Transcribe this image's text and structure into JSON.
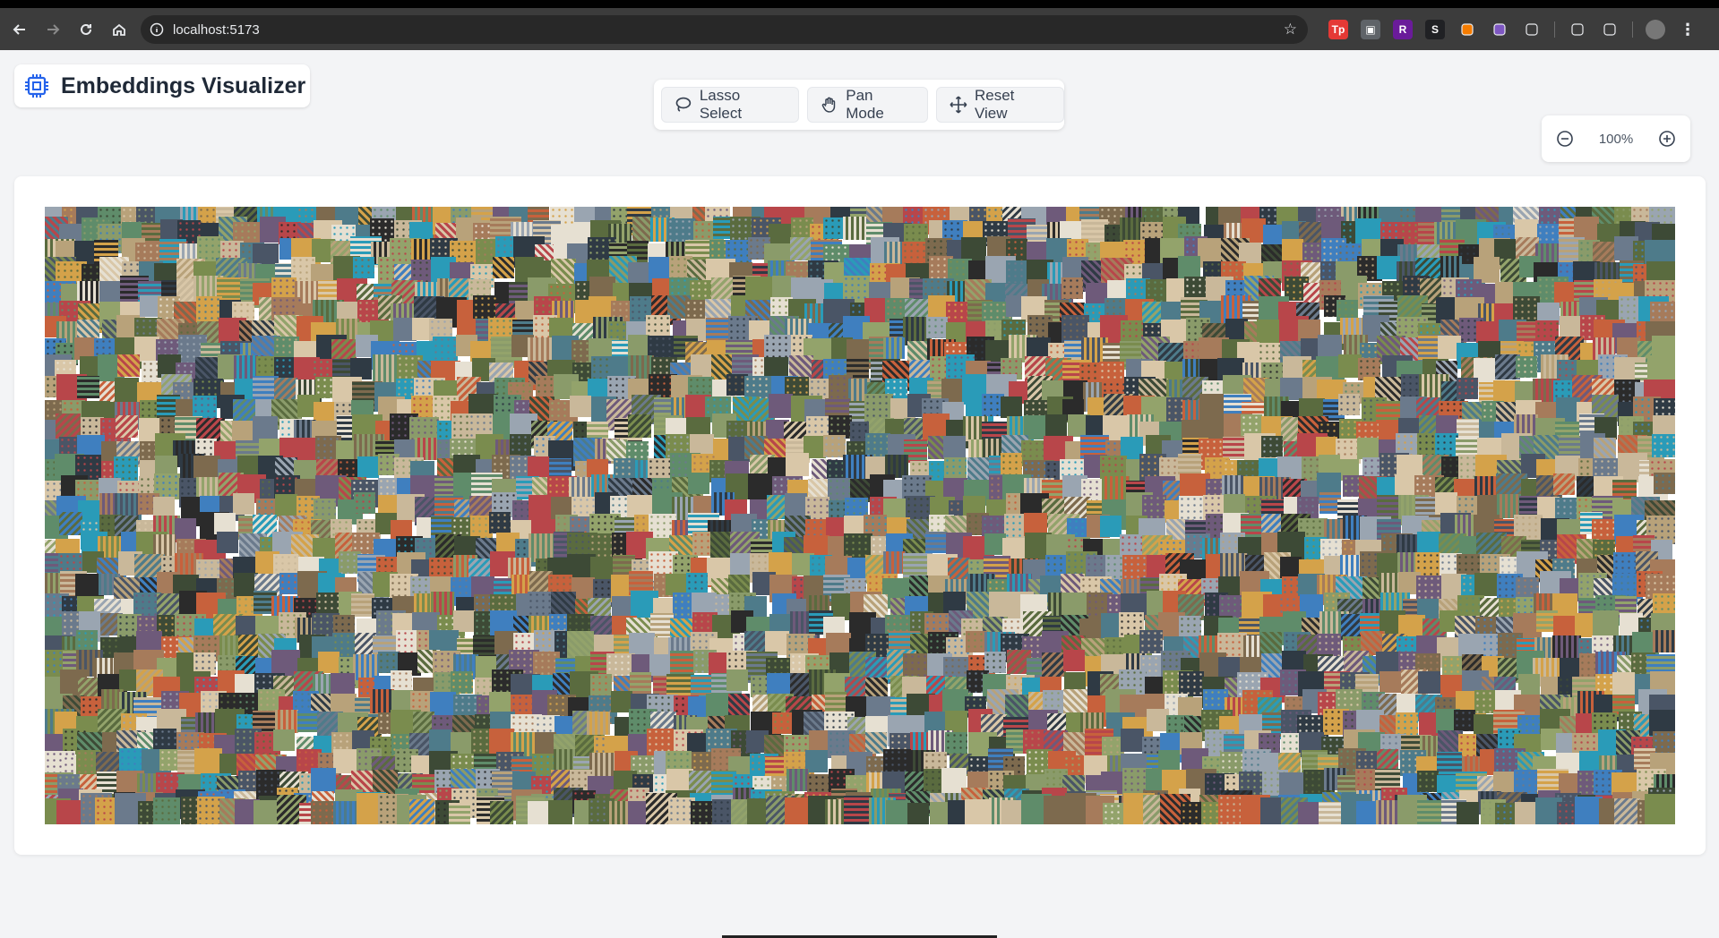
{
  "browser": {
    "url": "localhost:5173",
    "extensions": [
      {
        "name": "tp-icon",
        "label": "Tp",
        "color": "#e53935"
      },
      {
        "name": "window-icon",
        "label": "▣",
        "color": "#5f6368"
      },
      {
        "name": "r-extension-icon",
        "label": "R",
        "color": "#6a1b9a"
      },
      {
        "name": "s-extension-icon",
        "label": "S",
        "color": "#202124"
      },
      {
        "name": "fox-icon",
        "label": "",
        "color": "#f57c00"
      },
      {
        "name": "cloud-icon",
        "label": "",
        "color": "#7e57c2"
      },
      {
        "name": "puzzle-icon",
        "label": "",
        "color": "#3c3c3c"
      },
      {
        "name": "incognito-icon",
        "label": "",
        "color": "#3c3c3c"
      },
      {
        "name": "key-icon",
        "label": "",
        "color": "#3c3c3c"
      }
    ]
  },
  "app": {
    "title": "Embeddings Visualizer",
    "accent": "#2563eb"
  },
  "toolbar": {
    "lasso_label": "Lasso Select",
    "pan_label": "Pan Mode",
    "reset_label": "Reset View"
  },
  "zoom": {
    "value": "100%"
  },
  "mosaic": {
    "palette": [
      "#5a6b3f",
      "#7a8c4e",
      "#3d4a36",
      "#8a9b6a",
      "#4a5566",
      "#6b7a8c",
      "#2f3a44",
      "#9aa5b1",
      "#b8a27a",
      "#7d6a4e",
      "#c9b89a",
      "#4e7b8a",
      "#2a9bb8",
      "#3f7fbf",
      "#c7613c",
      "#b8464a",
      "#d4a24a",
      "#e6e0d2",
      "#2b2b2b",
      "#93a36b",
      "#5f8c6a",
      "#a67b5b",
      "#d9c7a8",
      "#6e5a7a"
    ]
  }
}
